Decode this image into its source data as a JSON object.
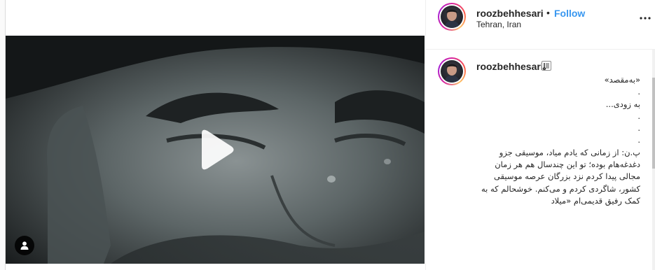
{
  "post": {
    "author": {
      "username": "roozbehhesari",
      "location": "Tehran, Iran",
      "separator": "•",
      "follow_label": "Follow"
    },
    "media": {
      "type": "video",
      "play_icon": "play-icon",
      "user_tag_icon": "user-tag-icon"
    },
    "caption": {
      "username": "roozbehhesari",
      "badge_icon": "music-note-icon",
      "lines": [
        "«به‌مقصد»",
        ".",
        "به زودی...",
        ".",
        ".",
        "."
      ],
      "paragraph": "پ.ن: از زمانی که یادم میاد، موسیقی جزو دغدغه‌هام بوده؛ تو این چندسال هم هر زمان مجالی پیدا کردم نزد بزرگان عرصه موسیقی کشور، شاگردی کردم و می‌کنم. خوشحالم که به کمک رفیق قدیمی‌ام «میلاد"
    },
    "colors": {
      "accent": "#3897f0",
      "text": "#262626",
      "border": "#dbdbdb"
    }
  }
}
